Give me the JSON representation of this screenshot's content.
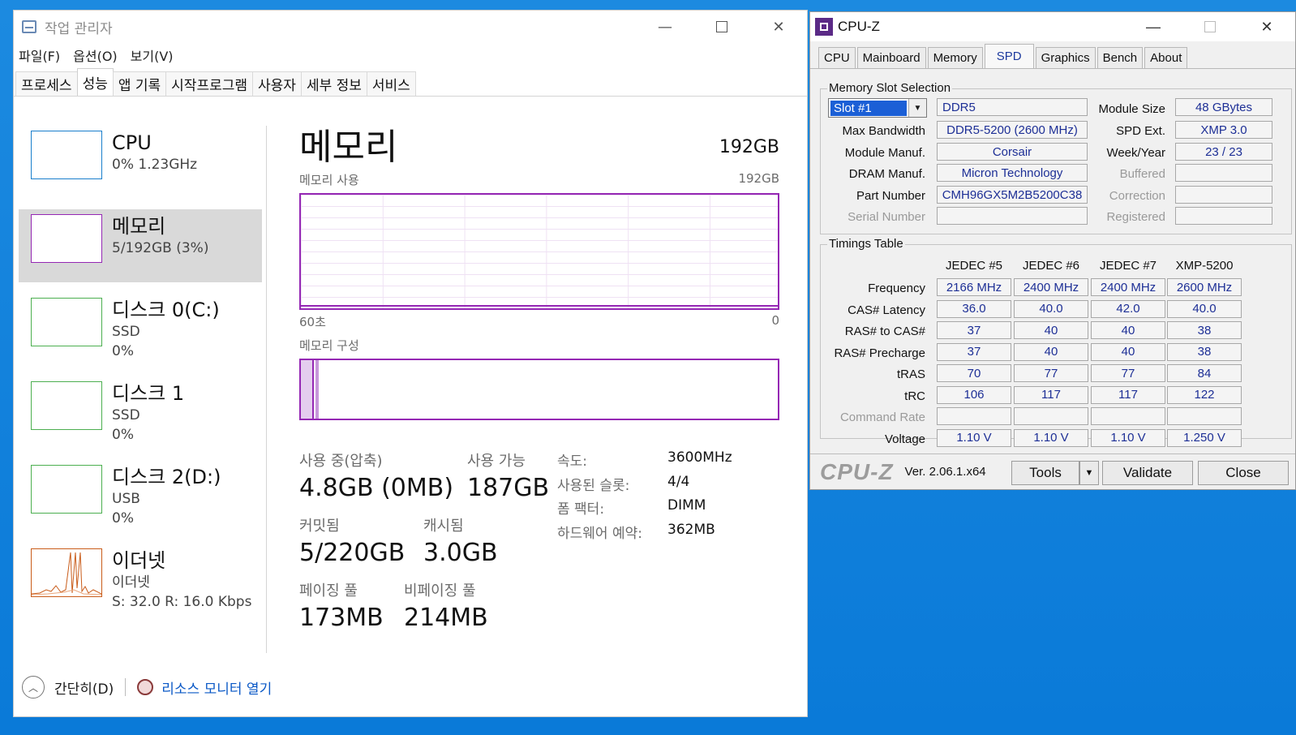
{
  "taskmanager": {
    "title": "작업 관리자",
    "menu": [
      "파일(F)",
      "옵션(O)",
      "보기(V)"
    ],
    "tabs": [
      "프로세스",
      "성능",
      "앱 기록",
      "시작프로그램",
      "사용자",
      "세부 정보",
      "서비스"
    ],
    "active_tab": "성능",
    "resources": [
      {
        "name": "CPU",
        "sub1": "0%  1.23GHz",
        "sub2": "",
        "color": "#1a7fcc"
      },
      {
        "name": "메모리",
        "sub1": "5/192GB (3%)",
        "sub2": "",
        "color": "#9528b4"
      },
      {
        "name": "디스크 0(C:)",
        "sub1": "SSD",
        "sub2": "0%",
        "color": "#4caf50"
      },
      {
        "name": "디스크 1",
        "sub1": "SSD",
        "sub2": "0%",
        "color": "#4caf50"
      },
      {
        "name": "디스크 2(D:)",
        "sub1": "USB",
        "sub2": "0%",
        "color": "#4caf50"
      },
      {
        "name": "이더넷",
        "sub1": "이더넷",
        "sub2": "S: 32.0  R: 16.0 Kbps",
        "color": "#c95c1a"
      }
    ],
    "main": {
      "title": "메모리",
      "capacity": "192GB",
      "usage_label": "메모리 사용",
      "usage_max": "192GB",
      "axis_left": "60초",
      "axis_right": "0",
      "composition_label": "메모리 구성",
      "stats": {
        "in_use_label": "사용 중(압축)",
        "in_use_value": "4.8GB (0MB)",
        "available_label": "사용 가능",
        "available_value": "187GB",
        "committed_label": "커밋됨",
        "committed_value": "5/220GB",
        "cached_label": "캐시됨",
        "cached_value": "3.0GB",
        "paged_label": "페이징 풀",
        "paged_value": "173MB",
        "nonpaged_label": "비페이징 풀",
        "nonpaged_value": "214MB"
      },
      "specs": [
        {
          "k": "속도:",
          "v": "3600MHz"
        },
        {
          "k": "사용된 슬롯:",
          "v": "4/4"
        },
        {
          "k": "폼 팩터:",
          "v": "DIMM"
        },
        {
          "k": "하드웨어 예약:",
          "v": "362MB"
        }
      ]
    },
    "footer": {
      "collapse": "간단히(D)",
      "resmon": "리소스 모니터 열기"
    }
  },
  "cpuz": {
    "title": "CPU-Z",
    "tabs": [
      "CPU",
      "Mainboard",
      "Memory",
      "SPD",
      "Graphics",
      "Bench",
      "About"
    ],
    "active_tab": "SPD",
    "slot_group": "Memory Slot Selection",
    "slot": "Slot #1",
    "type": "DDR5",
    "module_size_label": "Module Size",
    "module_size": "48 GBytes",
    "max_bw_label": "Max Bandwidth",
    "max_bw": "DDR5-5200 (2600 MHz)",
    "spd_ext_label": "SPD Ext.",
    "spd_ext": "XMP 3.0",
    "module_manuf_label": "Module Manuf.",
    "module_manuf": "Corsair",
    "week_year_label": "Week/Year",
    "week_year": "23 / 23",
    "dram_manuf_label": "DRAM Manuf.",
    "dram_manuf": "Micron Technology",
    "buffered_label": "Buffered",
    "part_label": "Part Number",
    "part": "CMH96GX5M2B5200C38",
    "correction_label": "Correction",
    "serial_label": "Serial Number",
    "registered_label": "Registered",
    "timings_group": "Timings Table",
    "columns": [
      "JEDEC #5",
      "JEDEC #6",
      "JEDEC #7",
      "XMP-5200"
    ],
    "timings": [
      {
        "label": "Frequency",
        "values": [
          "2166 MHz",
          "2400 MHz",
          "2400 MHz",
          "2600 MHz"
        ]
      },
      {
        "label": "CAS# Latency",
        "values": [
          "36.0",
          "40.0",
          "42.0",
          "40.0"
        ]
      },
      {
        "label": "RAS# to CAS#",
        "values": [
          "37",
          "40",
          "40",
          "38"
        ]
      },
      {
        "label": "RAS# Precharge",
        "values": [
          "37",
          "40",
          "40",
          "38"
        ]
      },
      {
        "label": "tRAS",
        "values": [
          "70",
          "77",
          "77",
          "84"
        ]
      },
      {
        "label": "tRC",
        "values": [
          "106",
          "117",
          "117",
          "122"
        ]
      },
      {
        "label": "Command Rate",
        "values": [
          "",
          "",
          "",
          ""
        ]
      },
      {
        "label": "Voltage",
        "values": [
          "1.10 V",
          "1.10 V",
          "1.10 V",
          "1.250 V"
        ]
      }
    ],
    "logo": "CPU-Z",
    "version": "Ver. 2.06.1.x64",
    "tools": "Tools",
    "validate": "Validate",
    "close": "Close"
  }
}
